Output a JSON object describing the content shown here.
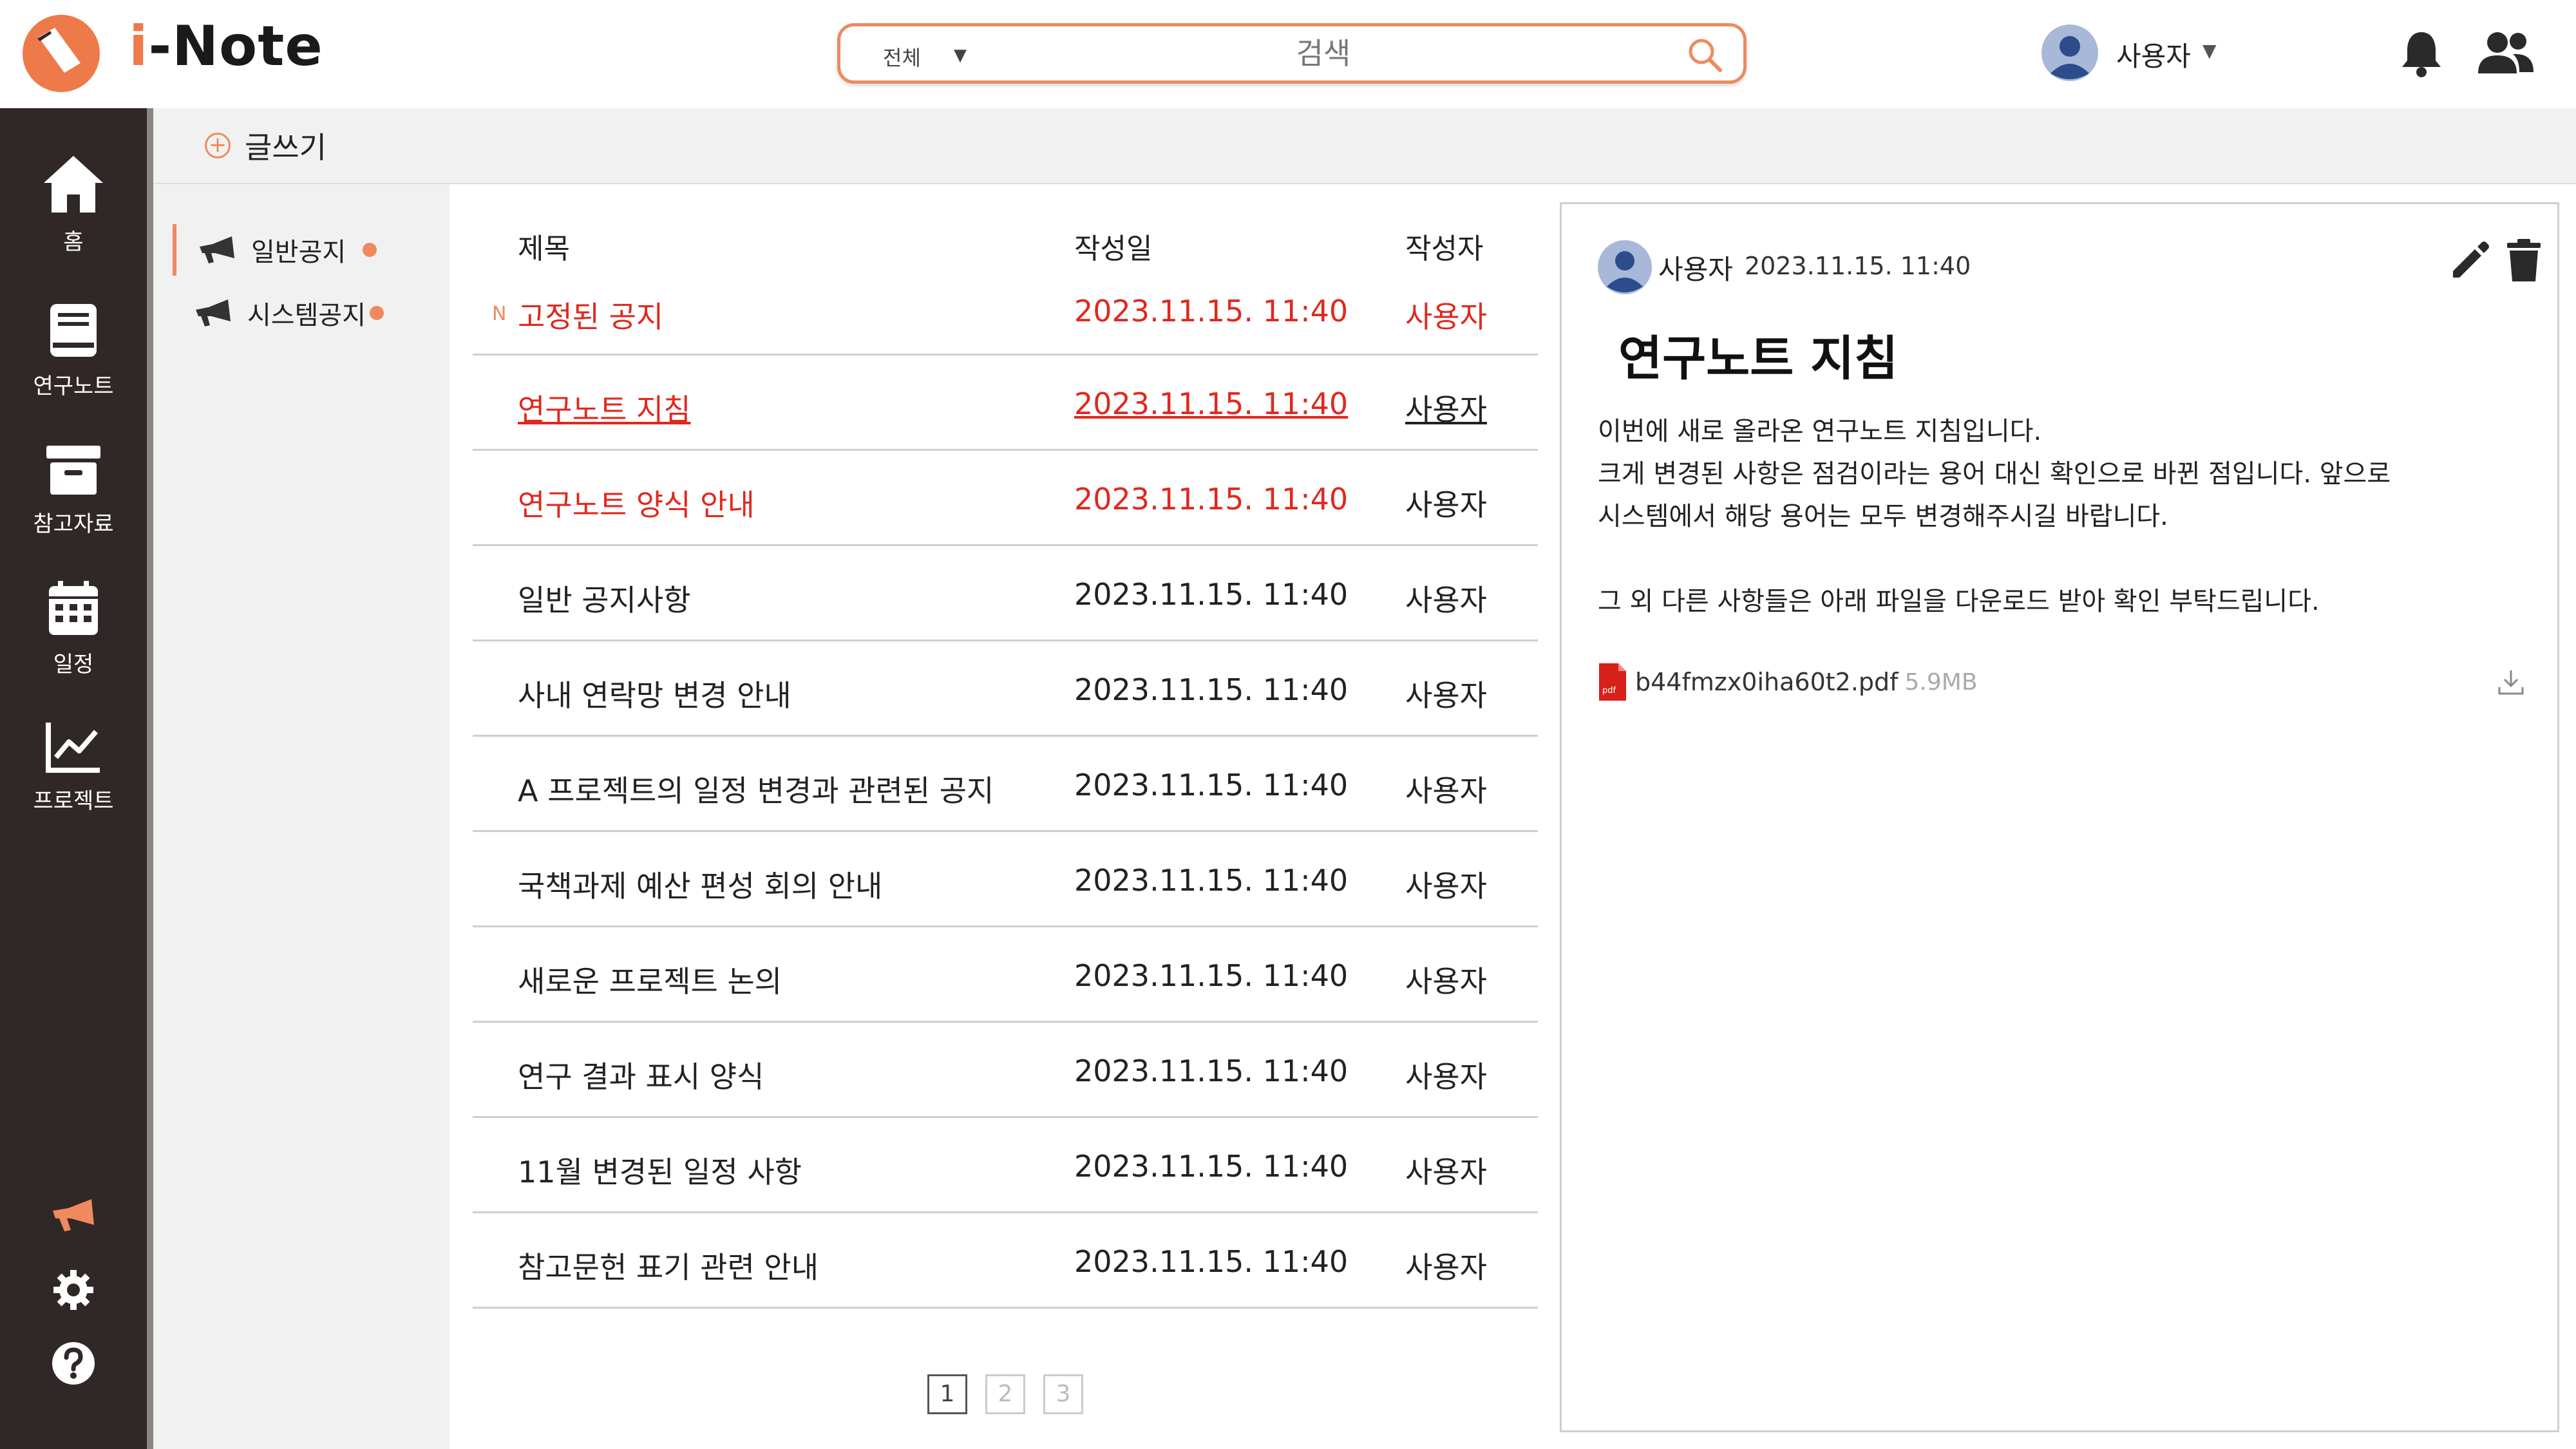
{
  "app": {
    "name_prefix": "i",
    "name_rest": "-Note"
  },
  "colors": {
    "accent": "#ee8a5e",
    "sidebar": "#2f2826",
    "alert_red": "#e0281e"
  },
  "search": {
    "scope": "전체",
    "placeholder": "검색"
  },
  "user": {
    "name": "사용자"
  },
  "header_icons": [
    "bell-icon",
    "people-icon"
  ],
  "nav": {
    "items": [
      {
        "label": "홈",
        "icon": "home-icon"
      },
      {
        "label": "연구노트",
        "icon": "notebook-icon"
      },
      {
        "label": "참고자료",
        "icon": "archive-icon"
      },
      {
        "label": "일정",
        "icon": "calendar-icon"
      },
      {
        "label": "프로젝트",
        "icon": "chart-icon"
      }
    ],
    "bottom_icons": [
      "megaphone-icon",
      "gear-icon",
      "help-icon"
    ]
  },
  "toolbar": {
    "write_label": "글쓰기"
  },
  "categories": [
    {
      "label": "일반공지",
      "active": true
    },
    {
      "label": "시스템공지",
      "active": false
    }
  ],
  "list": {
    "headers": {
      "title": "제목",
      "date": "작성일",
      "author": "작성자"
    },
    "new_mark": "N",
    "rows": [
      {
        "title": "고정된 공지",
        "date": "2023.11.15. 11:40",
        "author": "사용자"
      },
      {
        "title": "연구노트 지침",
        "date": "2023.11.15. 11:40",
        "author": "사용자"
      },
      {
        "title": "연구노트 양식 안내",
        "date": "2023.11.15. 11:40",
        "author": "사용자"
      },
      {
        "title": "일반 공지사항",
        "date": "2023.11.15. 11:40",
        "author": "사용자"
      },
      {
        "title": "사내 연락망 변경 안내",
        "date": "2023.11.15. 11:40",
        "author": "사용자"
      },
      {
        "title": "A 프로젝트의 일정 변경과 관련된 공지",
        "date": "2023.11.15. 11:40",
        "author": "사용자"
      },
      {
        "title": "국책과제 예산 편성 회의 안내",
        "date": "2023.11.15. 11:40",
        "author": "사용자"
      },
      {
        "title": "새로운 프로젝트 논의",
        "date": "2023.11.15. 11:40",
        "author": "사용자"
      },
      {
        "title": "연구 결과 표시 양식",
        "date": "2023.11.15. 11:40",
        "author": "사용자"
      },
      {
        "title": "11월 변경된 일정 사항",
        "date": "2023.11.15. 11:40",
        "author": "사용자"
      },
      {
        "title": "참고문헌 표기 관련 안내",
        "date": "2023.11.15. 11:40",
        "author": "사용자"
      }
    ],
    "pages": [
      "1",
      "2",
      "3"
    ]
  },
  "detail": {
    "author": "사용자",
    "date": "2023.11.15. 11:40",
    "title": "연구노트 지침",
    "body": [
      " 이번에 새로 올라온 연구노트 지침입니다.",
      "크게 변경된 사항은 점검이라는 용어 대신 확인으로 바뀐 점입니다. 앞으로",
      "시스템에서 해당 용어는 모두 변경해주시길 바랍니다.",
      "",
      " 그 외 다른 사항들은 아래 파일을 다운로드 받아 확인 부탁드립니다."
    ],
    "file": {
      "name": "b44fmzx0iha60t2.pdf",
      "size": "5.9MB",
      "type_label": "pdf"
    }
  }
}
